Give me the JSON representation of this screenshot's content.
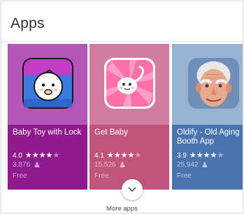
{
  "section": {
    "title": "Apps"
  },
  "apps": [
    {
      "name": "Baby Toy with Lock",
      "rating": "4.0",
      "stars_full": "★★★★",
      "stars_empty": "★",
      "reviews": "3,876",
      "price": "Free",
      "icon": "baby-face-icon"
    },
    {
      "name": "Get Baby",
      "rating": "4.1",
      "stars_full": "★★★★",
      "stars_empty": "★",
      "reviews": "15,526",
      "price": "Free",
      "icon": "sperm-icon"
    },
    {
      "name": "Oldify - Old Aging Booth App",
      "rating": "3.9",
      "stars_full": "★★★★",
      "stars_empty": "★",
      "reviews": "25,942",
      "price": "Free",
      "icon": "old-man-face-icon"
    }
  ],
  "more": {
    "label": "More apps",
    "icon": "chevron-down-icon"
  },
  "colors": {
    "tile1_top": "#b256ba",
    "tile1_bottom": "#8f1a8d",
    "tile2_top": "#d07d9f",
    "tile2_bottom": "#c0547c",
    "tile3_top": "#9ab2d3",
    "tile3_bottom": "#4a74ad"
  }
}
